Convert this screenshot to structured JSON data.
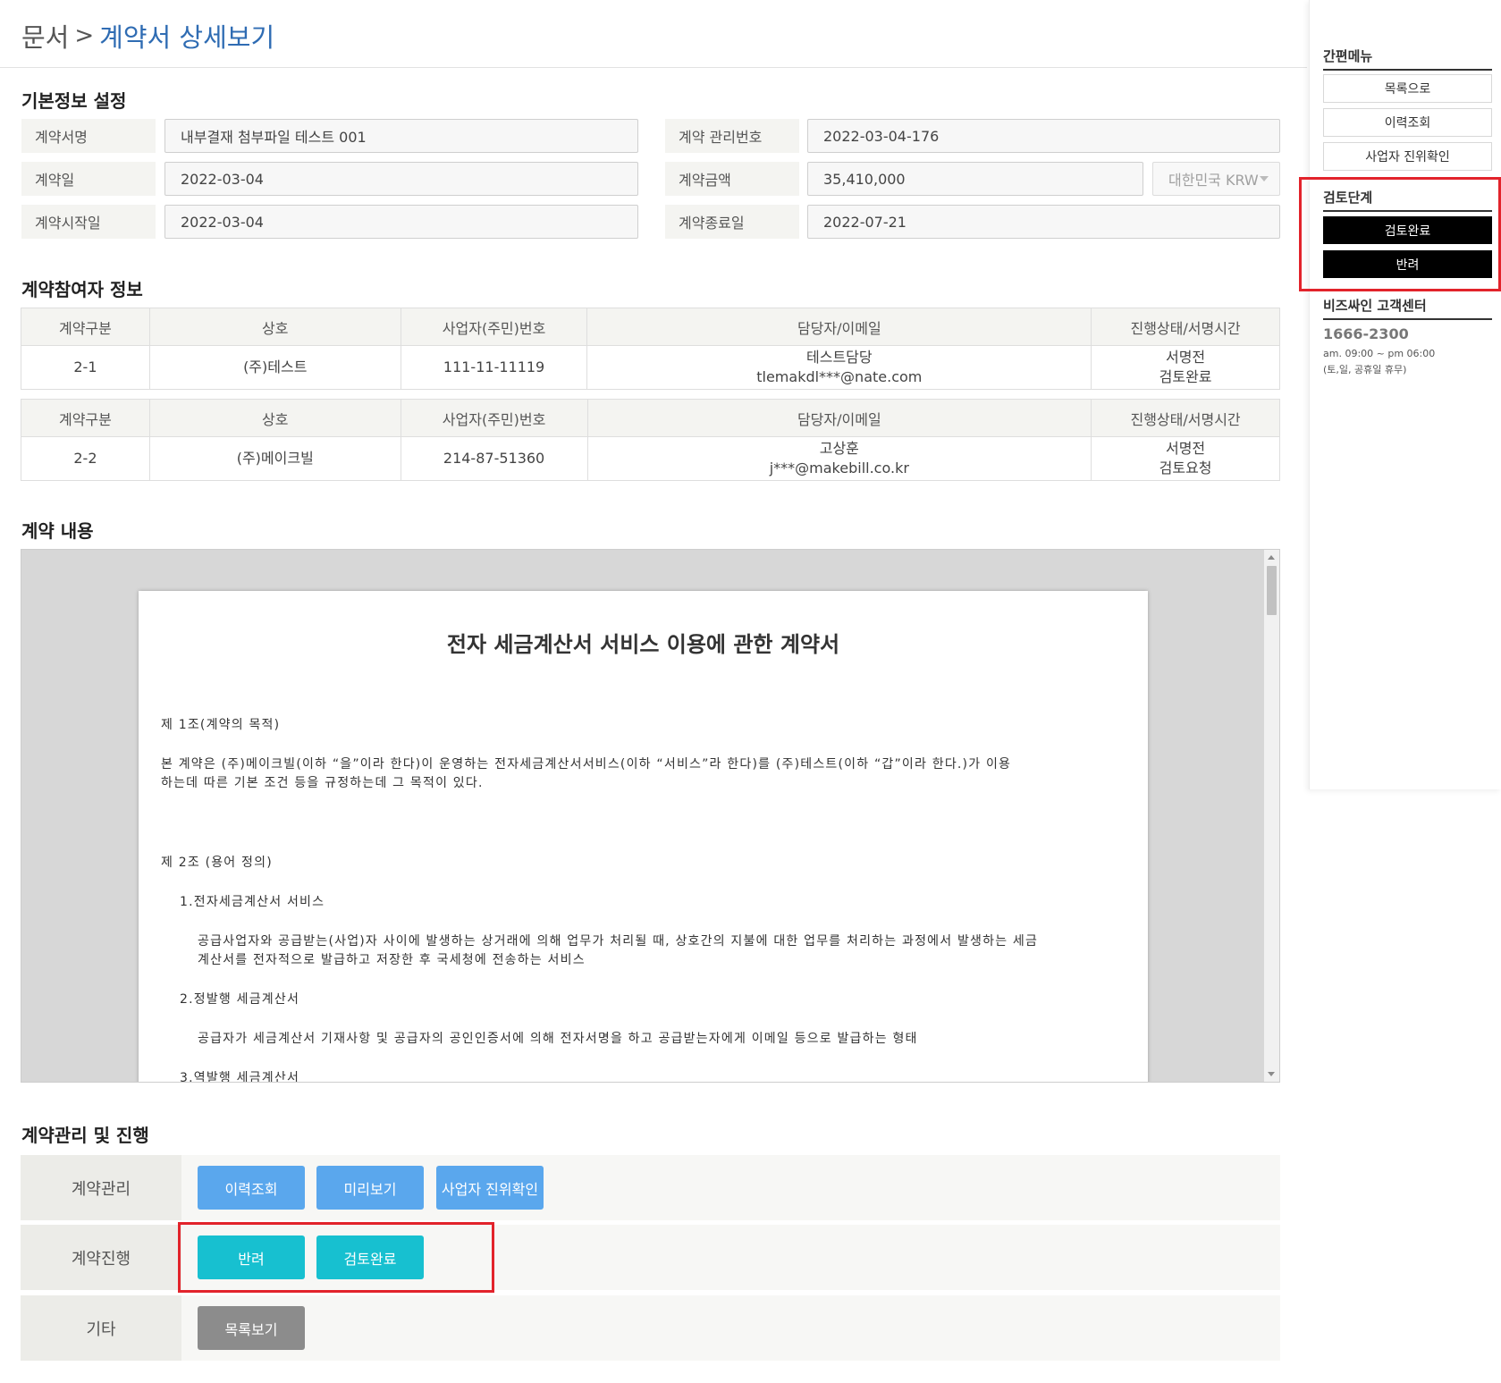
{
  "header": {
    "crumb": "문서",
    "separator": ">",
    "current": "계약서 상세보기"
  },
  "basic_info": {
    "title": "기본정보 설정",
    "fields": {
      "contract_name": {
        "label": "계약서명",
        "value": "내부결재 첨부파일 테스트 001"
      },
      "management_no": {
        "label": "계약 관리번호",
        "value": "2022-03-04-176"
      },
      "contract_date": {
        "label": "계약일",
        "value": "2022-03-04"
      },
      "amount": {
        "label": "계약금액",
        "value": "35,410,000"
      },
      "currency": {
        "value": "대한민국 KRW"
      },
      "start_date": {
        "label": "계약시작일",
        "value": "2022-03-04"
      },
      "end_date": {
        "label": "계약종료일",
        "value": "2022-07-21"
      }
    }
  },
  "participants": {
    "title": "계약참여자 정보",
    "columns": [
      "계약구분",
      "상호",
      "사업자(주민)번호",
      "담당자/이메일",
      "진행상태/서명시간"
    ],
    "rows": [
      {
        "type": "2-1",
        "company": "(주)테스트",
        "biz_no": "111-11-11119",
        "manager": "테스트담당",
        "email": "tlemakdl***@nate.com",
        "status": "서명전",
        "review": "검토완료"
      },
      {
        "type": "2-2",
        "company": "(주)메이크빌",
        "biz_no": "214-87-51360",
        "manager": "고상훈",
        "email": "j***@makebill.co.kr",
        "status": "서명전",
        "review": "검토요청"
      }
    ]
  },
  "contract_content": {
    "title": "계약 내용",
    "doc_title": "전자 세금계산서 서비스 이용에 관한 계약서",
    "lines": [
      "제 1조(계약의 목적)",
      "본 계약은 (주)메이크빌(이하 “을”이라 한다)이 운영하는 전자세금계산서서비스(이하 “서비스”라 한다)를 (주)테스트(이하 “갑”이라 한다.)가 이용",
      "하는데 따른 기본 조건 등을 규정하는데 그 목적이 있다.",
      "제 2조 (용어 정의)",
      "1.전자세금계산서 서비스",
      "공급사업자와 공급받는(사업)자 사이에 발생하는 상거래에 의해 업무가 처리될 때, 상호간의 지불에 대한 업무를 처리하는 과정에서 발생하는 세금",
      "계산서를 전자적으로 발급하고 저장한 후 국세청에 전송하는 서비스",
      "2.정발행 세금계산서",
      "공급자가 세금계산서 기재사항 및 공급자의 공인인증서에 의해 전자서명을 하고 공급받는자에게 이메일 등으로 발급하는 형태",
      "3.역발행 세금계산서"
    ]
  },
  "management": {
    "title": "계약관리 및 진행",
    "rows": {
      "manage": {
        "label": "계약관리",
        "buttons": [
          "이력조회",
          "미리보기",
          "사업자 진위확인"
        ]
      },
      "progress": {
        "label": "계약진행",
        "buttons": [
          "반려",
          "검토완료"
        ]
      },
      "etc": {
        "label": "기타",
        "buttons": [
          "목록보기"
        ]
      }
    }
  },
  "sidebar": {
    "quick_menu": {
      "title": "간편메뉴",
      "items": [
        "목록으로",
        "이력조회",
        "사업자 진위확인"
      ]
    },
    "review_stage": {
      "title": "검토단계",
      "items": [
        "검토완료",
        "반려"
      ]
    },
    "customer_center": {
      "title": "비즈싸인 고객센터",
      "phone": "1666-2300",
      "hours": "am. 09:00 ~ pm 06:00",
      "closed": "(토,일, 공휴일 휴무)"
    }
  },
  "colors": {
    "accent_blue": "#2f6cb3",
    "button_blue": "#5aa7ed",
    "button_teal": "#17c0d0",
    "button_gray": "#8c8c8c",
    "highlight_red": "#e2232b"
  }
}
